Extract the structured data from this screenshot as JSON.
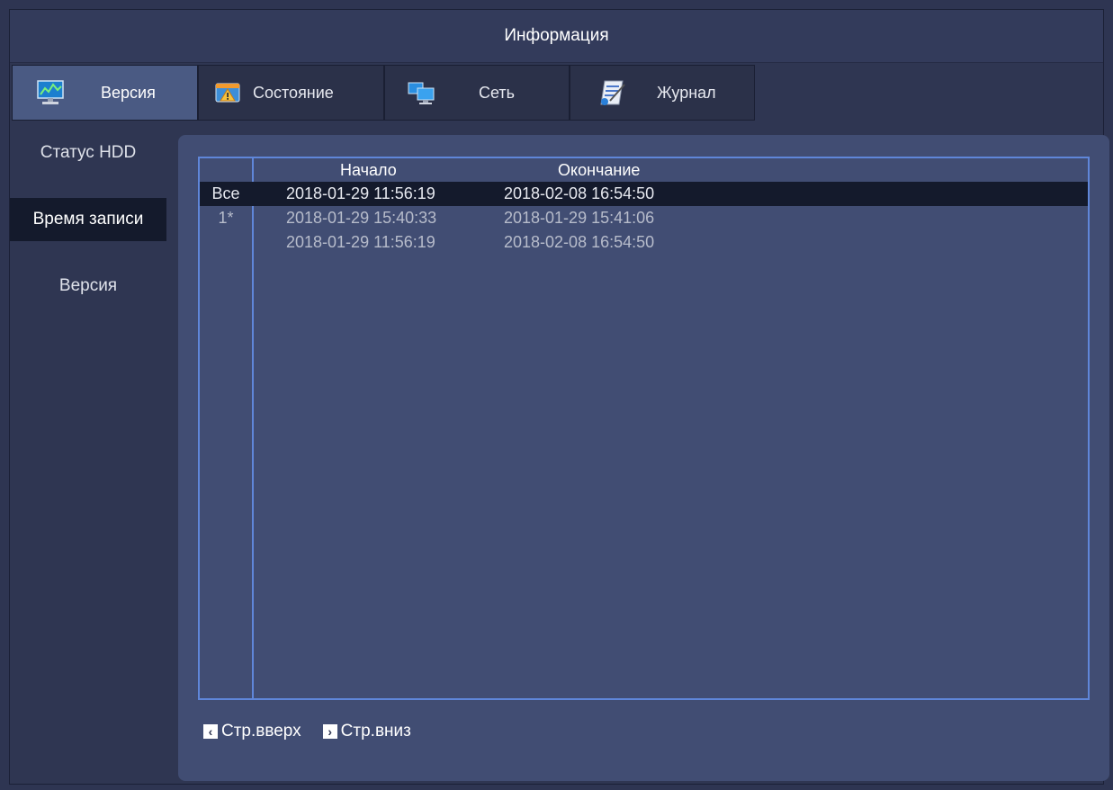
{
  "window": {
    "title": "Информация"
  },
  "tabs": [
    {
      "label": "Версия",
      "icon": "monitor-icon",
      "active": true
    },
    {
      "label": "Состояние",
      "icon": "warning-icon",
      "active": false
    },
    {
      "label": "Сеть",
      "icon": "network-icon",
      "active": false
    },
    {
      "label": "Журнал",
      "icon": "log-icon",
      "active": false
    }
  ],
  "sidebar": {
    "items": [
      {
        "label": "Статус HDD",
        "active": false
      },
      {
        "label": "Время записи",
        "active": true
      },
      {
        "label": "Версия",
        "active": false
      }
    ]
  },
  "table": {
    "columns": {
      "start": "Начало",
      "end": "Окончание"
    },
    "rows": [
      {
        "channel": "Все",
        "start": "2018-01-29 11:56:19",
        "end": "2018-02-08 16:54:50",
        "selected": true
      },
      {
        "channel": "1*",
        "start": "2018-01-29 15:40:33",
        "end": "2018-01-29 15:41:06",
        "selected": false
      },
      {
        "channel": "",
        "start": "2018-01-29 11:56:19",
        "end": "2018-02-08 16:54:50",
        "selected": false
      }
    ]
  },
  "pager": {
    "up_label": "Стр.вверх",
    "down_label": "Стр.вниз"
  },
  "colors": {
    "background": "#2e3552",
    "panel": "#414d73",
    "accent_border": "#5f86d9",
    "selected_row": "#141a2c",
    "active_tab": "#4a5a83"
  }
}
